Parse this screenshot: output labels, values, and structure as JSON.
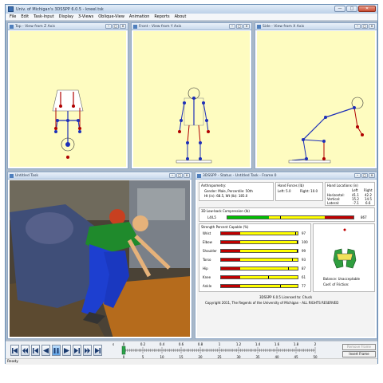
{
  "window": {
    "title": "Univ. of Michigan's 3DSSPP 6.0.5 - kneel.tsk",
    "minimize": "—",
    "maximize": "□",
    "close": "✕"
  },
  "menu": [
    "File",
    "Edit",
    "Task-Input",
    "Display",
    "3-Views",
    "Oblique-View",
    "Animation",
    "Reports",
    "About"
  ],
  "views": {
    "top": "Top - View from Z Axis",
    "front": "Front - View from Y Axis",
    "side": "Side - View from X Axis"
  },
  "task_window": {
    "title": "Untitled Task"
  },
  "status_window": {
    "title": "3DSSPP - Status - Untitled Task - Frame 0",
    "anthropometry_label": "Anthropometry:",
    "gender_line": "Gender: Male, Percentile: 50th",
    "height_weight_line": "Ht (in): 68.5, Wt (lb): 185.0",
    "hand_forces_label": "Hand Forces (lb)",
    "hand_forces_left": "Left: 5.0",
    "hand_forces_right": "Right: 10.0",
    "hand_locations_label": "Hand Locations (in)",
    "col_left": "Left",
    "col_right": "Right",
    "locations": [
      {
        "label": "Horizontal:",
        "left": "41.1",
        "right": "42.2"
      },
      {
        "label": "Vertical:",
        "left": "15.2",
        "right": "14.5"
      },
      {
        "label": "Lateral:",
        "left": "-7.1",
        "right": "6.6"
      }
    ],
    "compression_label": "3D Low-back Compression (lb)",
    "compression_row_label": "L4/L5",
    "compression_value": "867",
    "compression_fraction": 0.42,
    "strength_label": "Strength Percent Capable (%)",
    "strength": [
      {
        "label": "Wrist",
        "value": "97",
        "level": 0.97
      },
      {
        "label": "Elbow",
        "value": "100",
        "level": 1.0
      },
      {
        "label": "Shoulder",
        "value": "99",
        "level": 0.99
      },
      {
        "label": "Torso",
        "value": "93",
        "level": 0.93
      },
      {
        "label": "Hip",
        "value": "87",
        "level": 0.87
      },
      {
        "label": "Knee",
        "value": "61",
        "level": 0.61
      },
      {
        "label": "Ankle",
        "value": "77",
        "level": 0.77
      }
    ],
    "balance_line": "Balance: Unacceptable",
    "friction_line": "Coef. of Friction:",
    "license_line": "3DSSPP 6.0.5 Licensed to: Chuck",
    "copyright_line": "Copyright 2011, The Regents of the University of Michigan - ALL RIGHTS RESERVED"
  },
  "timeline": {
    "top_ticks": [
      "0",
      "0.2",
      "0.4",
      "0.6",
      "0.8",
      "1",
      "1.2",
      "1.4",
      "1.6",
      "1.8",
      "2"
    ],
    "bottom_ticks": [
      "0",
      "5",
      "10",
      "15",
      "20",
      "25",
      "30",
      "35",
      "40",
      "45",
      "50"
    ],
    "top_unit": "s"
  },
  "buttons": {
    "remove_frame": "Remove Frame",
    "insert_frame": "Insert Frame"
  },
  "statusbar": {
    "text": "Ready"
  },
  "colors": {
    "view_bg": "#fefcc0",
    "red": "#c00000",
    "yellow": "#ffff00",
    "green": "#00c000"
  }
}
